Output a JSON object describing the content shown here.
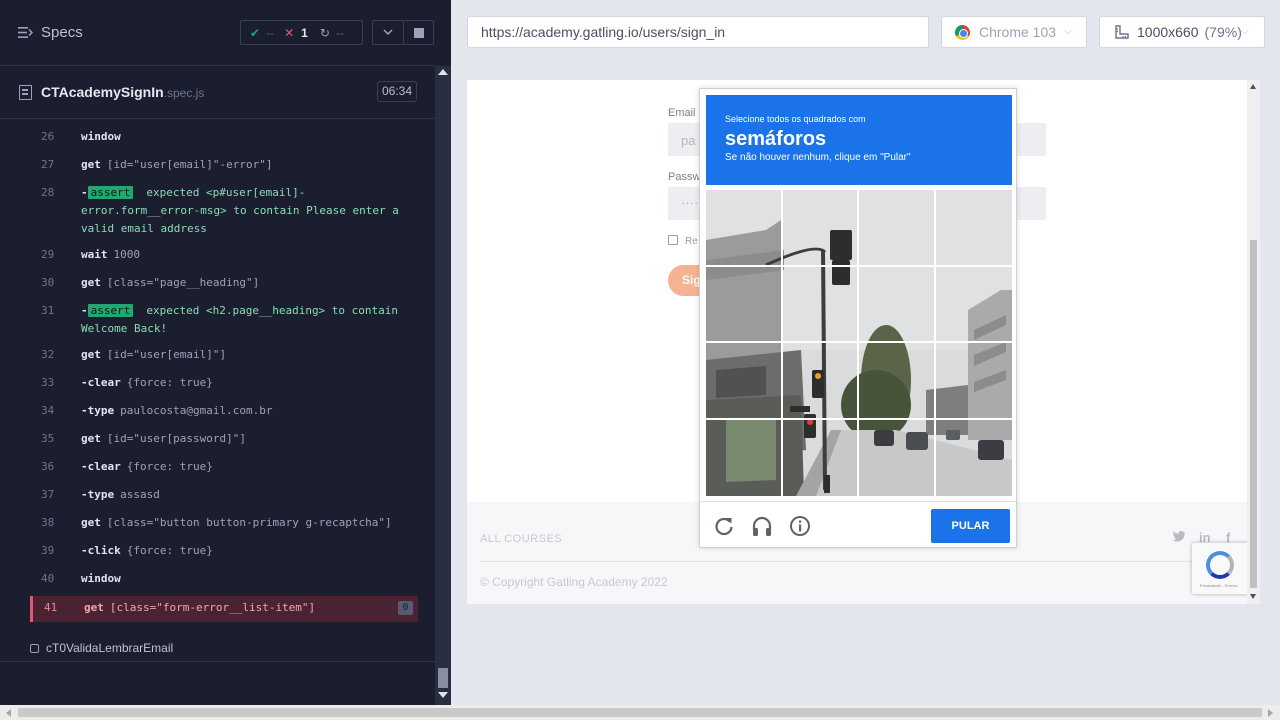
{
  "reporter": {
    "specs_label": "Specs",
    "stats": {
      "passed": "--",
      "failed": "1",
      "pending": "--"
    },
    "file": {
      "name": "CTAcademySignIn",
      "ext": ".spec.js",
      "duration": "06:34"
    },
    "commands": [
      {
        "n": "26",
        "name": "window",
        "msg": ""
      },
      {
        "n": "27",
        "name": "get",
        "msg": "[id=\"user[email]\"-error\"]"
      },
      {
        "n": "28",
        "type": "assert",
        "badge": "assert",
        "lines": [
          "expected <p#user[email]-",
          "error.form__error-msg> to contain Please enter a",
          "valid email address"
        ]
      },
      {
        "n": "29",
        "name": "wait",
        "msg": "1000"
      },
      {
        "n": "30",
        "name": "get",
        "msg": "[class=\"page__heading\"]"
      },
      {
        "n": "31",
        "type": "assert",
        "badge": "assert",
        "lines": [
          "expected <h2.page__heading> to contain",
          "Welcome Back!"
        ]
      },
      {
        "n": "32",
        "name": "get",
        "msg": "[id=\"user[email]\"]"
      },
      {
        "n": "33",
        "name": "-clear",
        "msg": "{force: true}"
      },
      {
        "n": "34",
        "name": "-type",
        "msg": "paulocosta@gmail.com.br"
      },
      {
        "n": "35",
        "name": "get",
        "msg": "[id=\"user[password]\"]"
      },
      {
        "n": "36",
        "name": "-clear",
        "msg": "{force: true}"
      },
      {
        "n": "37",
        "name": "-type",
        "msg": "assasd"
      },
      {
        "n": "38",
        "name": "get",
        "msg": "[class=\"button button-primary g-recaptcha\"]"
      },
      {
        "n": "39",
        "name": "-click",
        "msg": "{force: true}"
      },
      {
        "n": "40",
        "name": "window",
        "msg": ""
      },
      {
        "n": "41",
        "name": "get",
        "msg": "[class=\"form-error__list-item\"]",
        "failed": true,
        "count": "0"
      }
    ],
    "next_test": "cT0ValidaLembrarEmail"
  },
  "toolbar": {
    "url": "https://academy.gatling.io/users/sign_in",
    "browser": "Chrome 103",
    "viewport": "1000x660",
    "zoom": "(79%)"
  },
  "page": {
    "email_label": "Email",
    "email_placeholder": "pa",
    "password_label": "Passw",
    "password_value": "·····",
    "remember_label": "Re",
    "signin_label": "Sig",
    "all_courses": "ALL COURSES",
    "copyright": "© Copyright Gatling Academy 2022",
    "social": [
      "twitter-icon",
      "linkedin-icon",
      "facebook-icon"
    ],
    "recaptcha_small": "Privacidade - Termos"
  },
  "captcha": {
    "lead": "Selecione todos os quadrados com",
    "object": "semáforos",
    "hint": "Se não houver nenhum, clique em \"Pular\"",
    "skip": "PULAR",
    "icons": [
      "reload-icon",
      "audio-icon",
      "info-icon"
    ]
  },
  "colors": {
    "accent": "#1a73e8",
    "fail": "#e45770",
    "pass": "#1fa971",
    "reporter_bg": "#1b1e2e",
    "signin": "#f6b394"
  }
}
